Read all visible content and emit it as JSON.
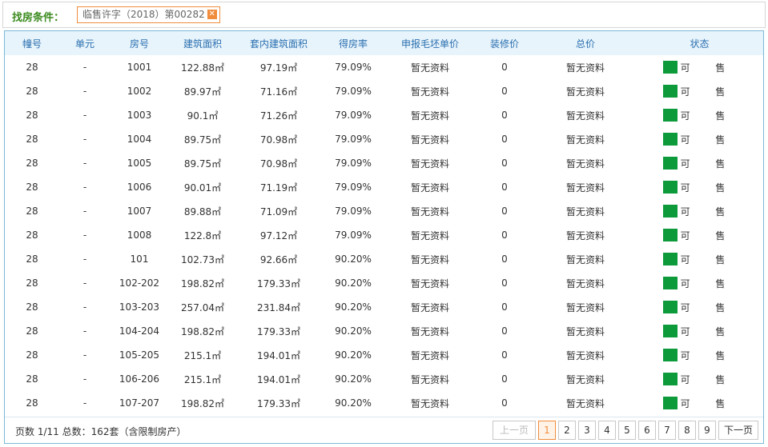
{
  "filter": {
    "label": "找房条件：",
    "tag": "临售许字（2018）第00282",
    "close": "✕"
  },
  "columns": [
    "幢号",
    "单元",
    "房号",
    "建筑面积",
    "套内建筑面积",
    "得房率",
    "申报毛坯单价",
    "装修价",
    "总价",
    "状态"
  ],
  "rows": [
    [
      "28",
      "-",
      "1001",
      "122.88㎡",
      "97.19㎡",
      "79.09%",
      "暂无资料",
      "0",
      "暂无资料",
      "可 售"
    ],
    [
      "28",
      "-",
      "1002",
      "89.97㎡",
      "71.16㎡",
      "79.09%",
      "暂无资料",
      "0",
      "暂无资料",
      "可 售"
    ],
    [
      "28",
      "-",
      "1003",
      "90.1㎡",
      "71.26㎡",
      "79.09%",
      "暂无资料",
      "0",
      "暂无资料",
      "可 售"
    ],
    [
      "28",
      "-",
      "1004",
      "89.75㎡",
      "70.98㎡",
      "79.09%",
      "暂无资料",
      "0",
      "暂无资料",
      "可 售"
    ],
    [
      "28",
      "-",
      "1005",
      "89.75㎡",
      "70.98㎡",
      "79.09%",
      "暂无资料",
      "0",
      "暂无资料",
      "可 售"
    ],
    [
      "28",
      "-",
      "1006",
      "90.01㎡",
      "71.19㎡",
      "79.09%",
      "暂无资料",
      "0",
      "暂无资料",
      "可 售"
    ],
    [
      "28",
      "-",
      "1007",
      "89.88㎡",
      "71.09㎡",
      "79.09%",
      "暂无资料",
      "0",
      "暂无资料",
      "可 售"
    ],
    [
      "28",
      "-",
      "1008",
      "122.8㎡",
      "97.12㎡",
      "79.09%",
      "暂无资料",
      "0",
      "暂无资料",
      "可 售"
    ],
    [
      "28",
      "-",
      "101",
      "102.73㎡",
      "92.66㎡",
      "90.20%",
      "暂无资料",
      "0",
      "暂无资料",
      "可 售"
    ],
    [
      "28",
      "-",
      "102-202",
      "198.82㎡",
      "179.33㎡",
      "90.20%",
      "暂无资料",
      "0",
      "暂无资料",
      "可 售"
    ],
    [
      "28",
      "-",
      "103-203",
      "257.04㎡",
      "231.84㎡",
      "90.20%",
      "暂无资料",
      "0",
      "暂无资料",
      "可 售"
    ],
    [
      "28",
      "-",
      "104-204",
      "198.82㎡",
      "179.33㎡",
      "90.20%",
      "暂无资料",
      "0",
      "暂无资料",
      "可 售"
    ],
    [
      "28",
      "-",
      "105-205",
      "215.1㎡",
      "194.01㎡",
      "90.20%",
      "暂无资料",
      "0",
      "暂无资料",
      "可 售"
    ],
    [
      "28",
      "-",
      "106-206",
      "215.1㎡",
      "194.01㎡",
      "90.20%",
      "暂无资料",
      "0",
      "暂无资料",
      "可 售"
    ],
    [
      "28",
      "-",
      "107-207",
      "198.82㎡",
      "179.33㎡",
      "90.20%",
      "暂无资料",
      "0",
      "暂无资料",
      "可 售"
    ]
  ],
  "status_color": "#0c9a3a",
  "footer": {
    "info": "页数 1/11 总数：162套（含限制房产）"
  },
  "pager": {
    "prev": "上一页",
    "pages": [
      "1",
      "2",
      "3",
      "4",
      "5",
      "6",
      "7",
      "8",
      "9"
    ],
    "current": "1",
    "next": "下一页"
  }
}
